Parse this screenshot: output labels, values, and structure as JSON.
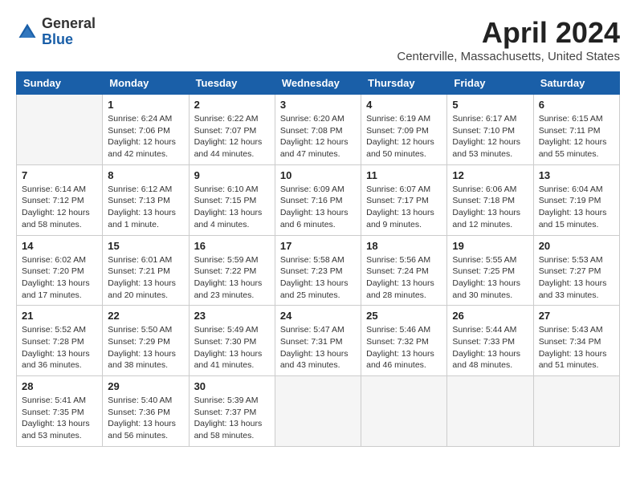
{
  "logo": {
    "general": "General",
    "blue": "Blue"
  },
  "title": {
    "month_year": "April 2024",
    "location": "Centerville, Massachusetts, United States"
  },
  "days_of_week": [
    "Sunday",
    "Monday",
    "Tuesday",
    "Wednesday",
    "Thursday",
    "Friday",
    "Saturday"
  ],
  "weeks": [
    [
      {
        "day": "",
        "sunrise": "",
        "sunset": "",
        "daylight": ""
      },
      {
        "day": "1",
        "sunrise": "Sunrise: 6:24 AM",
        "sunset": "Sunset: 7:06 PM",
        "daylight": "Daylight: 12 hours and 42 minutes."
      },
      {
        "day": "2",
        "sunrise": "Sunrise: 6:22 AM",
        "sunset": "Sunset: 7:07 PM",
        "daylight": "Daylight: 12 hours and 44 minutes."
      },
      {
        "day": "3",
        "sunrise": "Sunrise: 6:20 AM",
        "sunset": "Sunset: 7:08 PM",
        "daylight": "Daylight: 12 hours and 47 minutes."
      },
      {
        "day": "4",
        "sunrise": "Sunrise: 6:19 AM",
        "sunset": "Sunset: 7:09 PM",
        "daylight": "Daylight: 12 hours and 50 minutes."
      },
      {
        "day": "5",
        "sunrise": "Sunrise: 6:17 AM",
        "sunset": "Sunset: 7:10 PM",
        "daylight": "Daylight: 12 hours and 53 minutes."
      },
      {
        "day": "6",
        "sunrise": "Sunrise: 6:15 AM",
        "sunset": "Sunset: 7:11 PM",
        "daylight": "Daylight: 12 hours and 55 minutes."
      }
    ],
    [
      {
        "day": "7",
        "sunrise": "Sunrise: 6:14 AM",
        "sunset": "Sunset: 7:12 PM",
        "daylight": "Daylight: 12 hours and 58 minutes."
      },
      {
        "day": "8",
        "sunrise": "Sunrise: 6:12 AM",
        "sunset": "Sunset: 7:13 PM",
        "daylight": "Daylight: 13 hours and 1 minute."
      },
      {
        "day": "9",
        "sunrise": "Sunrise: 6:10 AM",
        "sunset": "Sunset: 7:15 PM",
        "daylight": "Daylight: 13 hours and 4 minutes."
      },
      {
        "day": "10",
        "sunrise": "Sunrise: 6:09 AM",
        "sunset": "Sunset: 7:16 PM",
        "daylight": "Daylight: 13 hours and 6 minutes."
      },
      {
        "day": "11",
        "sunrise": "Sunrise: 6:07 AM",
        "sunset": "Sunset: 7:17 PM",
        "daylight": "Daylight: 13 hours and 9 minutes."
      },
      {
        "day": "12",
        "sunrise": "Sunrise: 6:06 AM",
        "sunset": "Sunset: 7:18 PM",
        "daylight": "Daylight: 13 hours and 12 minutes."
      },
      {
        "day": "13",
        "sunrise": "Sunrise: 6:04 AM",
        "sunset": "Sunset: 7:19 PM",
        "daylight": "Daylight: 13 hours and 15 minutes."
      }
    ],
    [
      {
        "day": "14",
        "sunrise": "Sunrise: 6:02 AM",
        "sunset": "Sunset: 7:20 PM",
        "daylight": "Daylight: 13 hours and 17 minutes."
      },
      {
        "day": "15",
        "sunrise": "Sunrise: 6:01 AM",
        "sunset": "Sunset: 7:21 PM",
        "daylight": "Daylight: 13 hours and 20 minutes."
      },
      {
        "day": "16",
        "sunrise": "Sunrise: 5:59 AM",
        "sunset": "Sunset: 7:22 PM",
        "daylight": "Daylight: 13 hours and 23 minutes."
      },
      {
        "day": "17",
        "sunrise": "Sunrise: 5:58 AM",
        "sunset": "Sunset: 7:23 PM",
        "daylight": "Daylight: 13 hours and 25 minutes."
      },
      {
        "day": "18",
        "sunrise": "Sunrise: 5:56 AM",
        "sunset": "Sunset: 7:24 PM",
        "daylight": "Daylight: 13 hours and 28 minutes."
      },
      {
        "day": "19",
        "sunrise": "Sunrise: 5:55 AM",
        "sunset": "Sunset: 7:25 PM",
        "daylight": "Daylight: 13 hours and 30 minutes."
      },
      {
        "day": "20",
        "sunrise": "Sunrise: 5:53 AM",
        "sunset": "Sunset: 7:27 PM",
        "daylight": "Daylight: 13 hours and 33 minutes."
      }
    ],
    [
      {
        "day": "21",
        "sunrise": "Sunrise: 5:52 AM",
        "sunset": "Sunset: 7:28 PM",
        "daylight": "Daylight: 13 hours and 36 minutes."
      },
      {
        "day": "22",
        "sunrise": "Sunrise: 5:50 AM",
        "sunset": "Sunset: 7:29 PM",
        "daylight": "Daylight: 13 hours and 38 minutes."
      },
      {
        "day": "23",
        "sunrise": "Sunrise: 5:49 AM",
        "sunset": "Sunset: 7:30 PM",
        "daylight": "Daylight: 13 hours and 41 minutes."
      },
      {
        "day": "24",
        "sunrise": "Sunrise: 5:47 AM",
        "sunset": "Sunset: 7:31 PM",
        "daylight": "Daylight: 13 hours and 43 minutes."
      },
      {
        "day": "25",
        "sunrise": "Sunrise: 5:46 AM",
        "sunset": "Sunset: 7:32 PM",
        "daylight": "Daylight: 13 hours and 46 minutes."
      },
      {
        "day": "26",
        "sunrise": "Sunrise: 5:44 AM",
        "sunset": "Sunset: 7:33 PM",
        "daylight": "Daylight: 13 hours and 48 minutes."
      },
      {
        "day": "27",
        "sunrise": "Sunrise: 5:43 AM",
        "sunset": "Sunset: 7:34 PM",
        "daylight": "Daylight: 13 hours and 51 minutes."
      }
    ],
    [
      {
        "day": "28",
        "sunrise": "Sunrise: 5:41 AM",
        "sunset": "Sunset: 7:35 PM",
        "daylight": "Daylight: 13 hours and 53 minutes."
      },
      {
        "day": "29",
        "sunrise": "Sunrise: 5:40 AM",
        "sunset": "Sunset: 7:36 PM",
        "daylight": "Daylight: 13 hours and 56 minutes."
      },
      {
        "day": "30",
        "sunrise": "Sunrise: 5:39 AM",
        "sunset": "Sunset: 7:37 PM",
        "daylight": "Daylight: 13 hours and 58 minutes."
      },
      {
        "day": "",
        "sunrise": "",
        "sunset": "",
        "daylight": ""
      },
      {
        "day": "",
        "sunrise": "",
        "sunset": "",
        "daylight": ""
      },
      {
        "day": "",
        "sunrise": "",
        "sunset": "",
        "daylight": ""
      },
      {
        "day": "",
        "sunrise": "",
        "sunset": "",
        "daylight": ""
      }
    ]
  ]
}
